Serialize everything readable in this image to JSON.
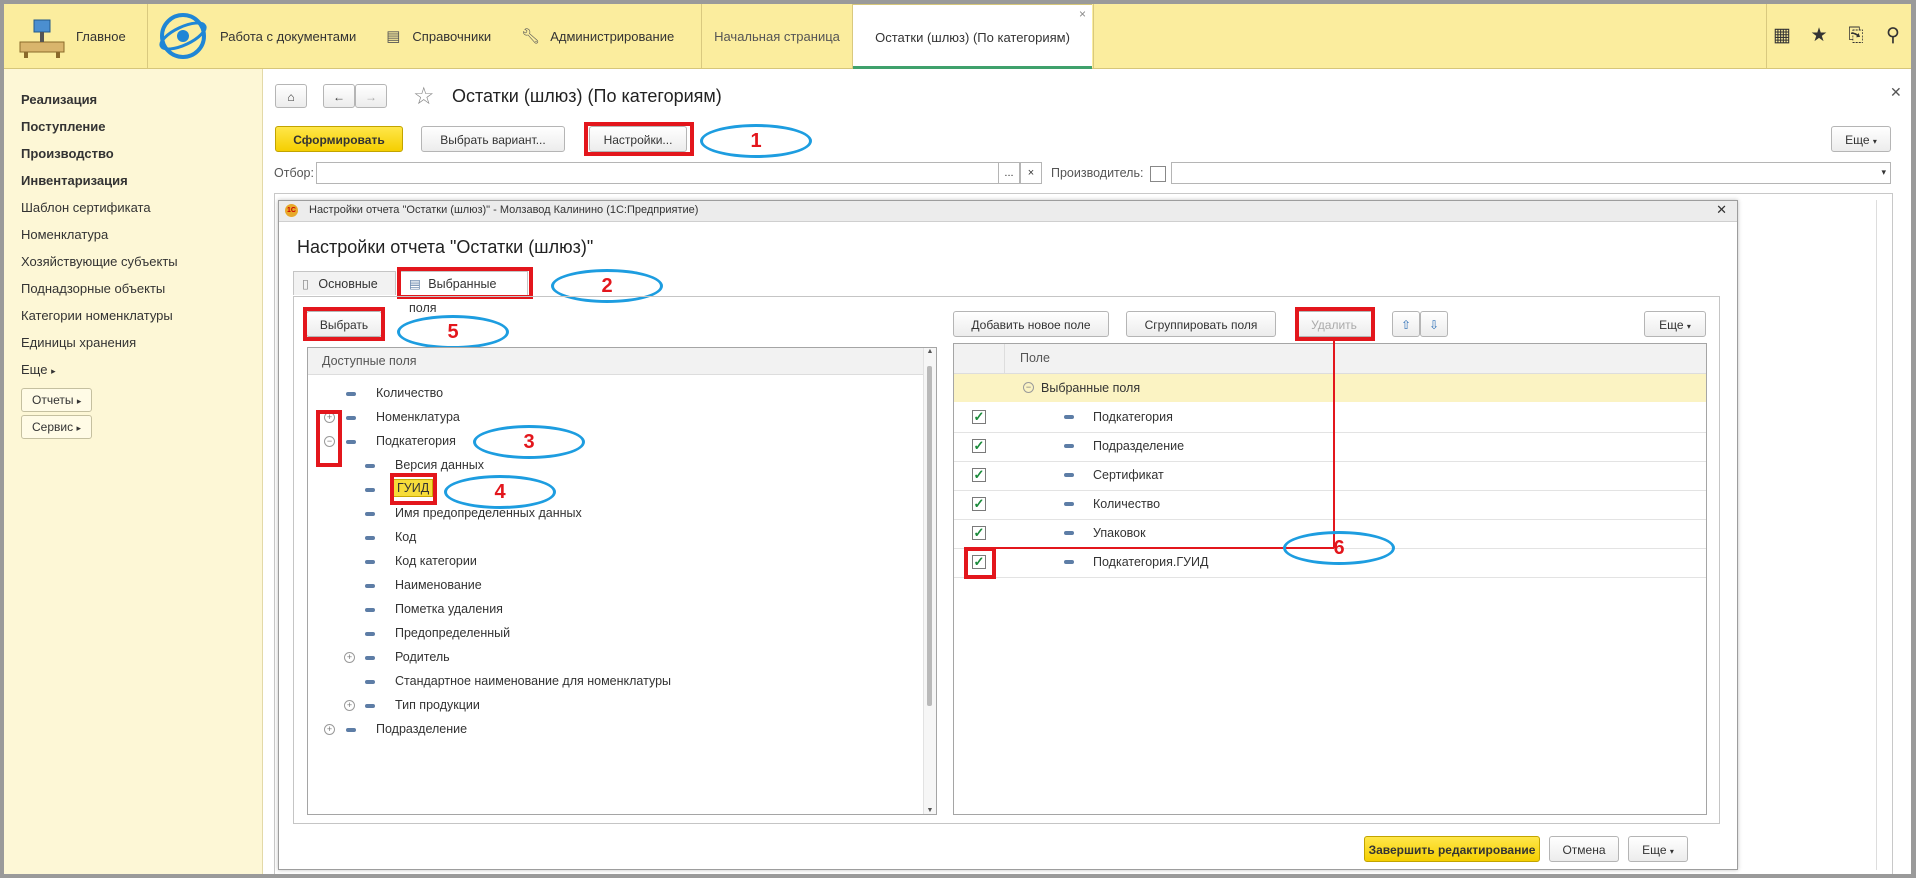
{
  "topbar": {
    "home_label": "Главное",
    "nav": [
      {
        "label": "Работа с документами"
      },
      {
        "label": "Справочники"
      },
      {
        "label": "Администрирование"
      }
    ],
    "tabs": [
      {
        "label": "Начальная страница"
      },
      {
        "label": "Остатки (шлюз) (По категориям)"
      }
    ],
    "tab_close": "×"
  },
  "sidebar": {
    "items": [
      {
        "label": "Реализация"
      },
      {
        "label": "Поступление"
      },
      {
        "label": "Производство"
      },
      {
        "label": "Инвентаризация"
      },
      {
        "label": "Шаблон сертификата"
      },
      {
        "label": "Номенклатура"
      },
      {
        "label": "Хозяйствующие субъекты"
      },
      {
        "label": "Поднадзорные объекты"
      },
      {
        "label": "Категории номенклатуры"
      },
      {
        "label": "Единицы хранения"
      },
      {
        "label": "Еще"
      }
    ],
    "buttons": [
      {
        "label": "Отчеты"
      },
      {
        "label": "Сервис"
      }
    ]
  },
  "report": {
    "title": "Остатки (шлюз) (По категориям)",
    "generate_label": "Сформировать",
    "choose_variant_label": "Выбрать вариант...",
    "settings_label": "Настройки...",
    "more_label": "Еще",
    "filter_label": "Отбор:",
    "filter_value": "",
    "producer_label": "Производитель:",
    "producer_value": "",
    "ellipsis": "..."
  },
  "dialog": {
    "window_title": "Настройки отчета \"Остатки (шлюз)\" - Молзавод Калинино  (1С:Предприятие)",
    "heading": "Настройки отчета \"Остатки (шлюз)\"",
    "tabs": [
      {
        "label": "Основные"
      },
      {
        "label": "Выбранные поля"
      }
    ],
    "select_label": "Выбрать",
    "available_header": "Доступные поля",
    "available": [
      {
        "label": "Количество"
      },
      {
        "label": "Номенклатура"
      },
      {
        "label": "Подкатегория"
      },
      {
        "label": "Версия данных"
      },
      {
        "label": "ГУИД"
      },
      {
        "label": "Имя предопределенных данных"
      },
      {
        "label": "Код"
      },
      {
        "label": "Код категории"
      },
      {
        "label": "Наименование"
      },
      {
        "label": "Пометка удаления"
      },
      {
        "label": "Предопределенный"
      },
      {
        "label": "Родитель"
      },
      {
        "label": "Стандартное наименование для номенклатуры"
      },
      {
        "label": "Тип продукции"
      },
      {
        "label": "Подразделение"
      }
    ],
    "add_field_label": "Добавить новое поле",
    "group_fields_label": "Сгруппировать поля",
    "delete_label": "Удалить",
    "more_label": "Еще",
    "field_header": "Поле",
    "group_label": "Выбранные поля",
    "selected": [
      {
        "label": "Подкатегория",
        "checked": true
      },
      {
        "label": "Подразделение",
        "checked": true
      },
      {
        "label": "Сертификат",
        "checked": true
      },
      {
        "label": "Количество",
        "checked": true
      },
      {
        "label": "Упаковок",
        "checked": true
      },
      {
        "label": "Подкатегория.ГУИД",
        "checked": true
      }
    ],
    "finish_label": "Завершить редактирование",
    "cancel_label": "Отмена",
    "footer_more_label": "Еще"
  },
  "callouts": [
    "1",
    "2",
    "3",
    "4",
    "5",
    "6"
  ],
  "colors": {
    "topbar": "#fbed9e",
    "sidebar": "#fdf7d6",
    "accent_yellow": "#f5cf00",
    "annotation_red": "#e3161c",
    "annotation_blue": "#1d9de0",
    "highlight_row": "#fbf3c3"
  }
}
